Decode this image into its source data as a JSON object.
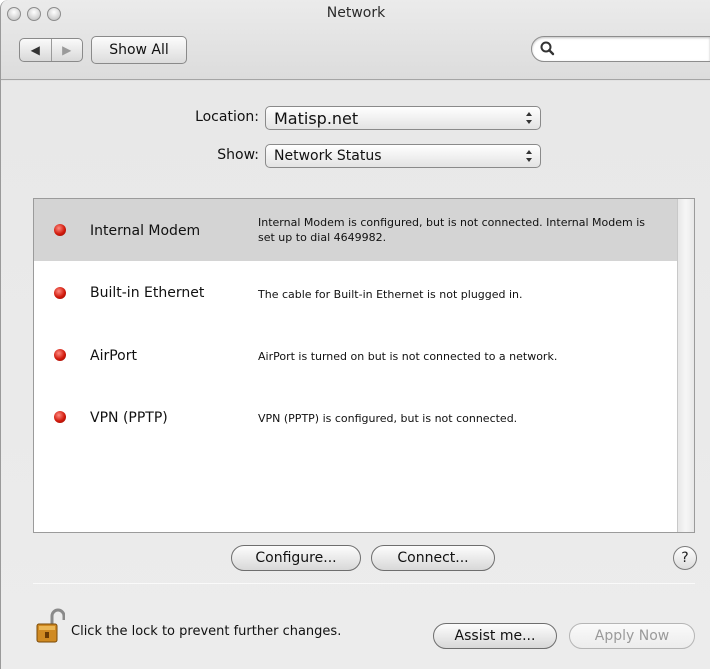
{
  "window": {
    "title": "Network"
  },
  "toolbar": {
    "back_icon": "back-arrow-icon",
    "forward_icon": "forward-arrow-icon",
    "show_all_label": "Show All",
    "search": {
      "value": "",
      "icon": "magnifier-icon"
    }
  },
  "location": {
    "label": "Location:",
    "value": "Matisp.net"
  },
  "show": {
    "label": "Show:",
    "value": "Network Status"
  },
  "status_list": [
    {
      "name": "Internal Modem",
      "description": "Internal Modem is configured, but is not connected. Internal Modem is set up to dial 4649982.",
      "status_color": "#d11a0c",
      "selected": true
    },
    {
      "name": "Built-in Ethernet",
      "description": "The cable for Built-in Ethernet is not plugged in.",
      "status_color": "#d11a0c",
      "selected": false
    },
    {
      "name": "AirPort",
      "description": "AirPort is turned on but is not connected to a network.",
      "status_color": "#d11a0c",
      "selected": false
    },
    {
      "name": "VPN (PPTP)",
      "description": "VPN (PPTP) is configured, but is not connected.",
      "status_color": "#d11a0c",
      "selected": false
    }
  ],
  "buttons": {
    "configure": "Configure...",
    "connect": "Connect...",
    "help": "?",
    "assist": "Assist me...",
    "apply": "Apply Now"
  },
  "lock": {
    "text": "Click the lock to prevent further changes.",
    "icon": "padlock-open-icon"
  }
}
